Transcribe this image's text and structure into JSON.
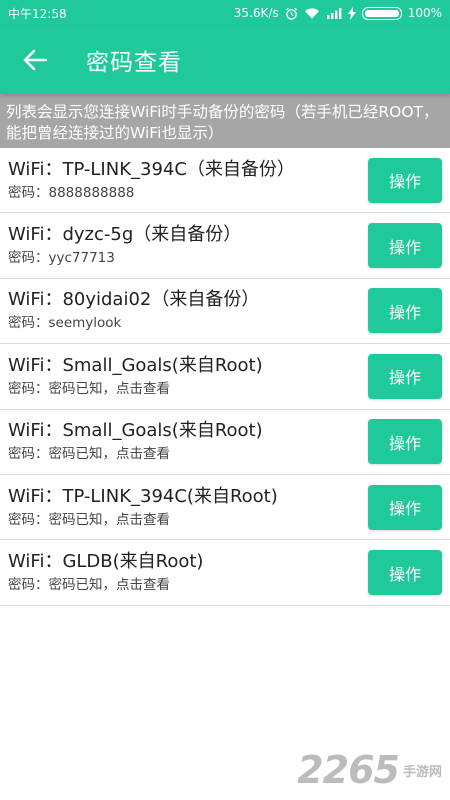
{
  "status_bar": {
    "time": "中午12:58",
    "speed": "35.6K/s",
    "battery": "100%"
  },
  "app_bar": {
    "title": "密码查看"
  },
  "notice": "列表会显示您连接WiFi时手动备份的密码（若手机已经ROOT，能把曾经连接过的WiFi也显示）",
  "items": [
    {
      "name": "WiFi：TP-LINK_394C（来自备份）",
      "password": "密码：8888888888",
      "button": "操作"
    },
    {
      "name": "WiFi：dyzc-5g（来自备份）",
      "password": "密码：yyc77713",
      "button": "操作"
    },
    {
      "name": "WiFi：80yidai02（来自备份）",
      "password": "密码：seemylook",
      "button": "操作"
    },
    {
      "name": "WiFi：Small_Goals(来自Root)",
      "password": "密码：密码已知，点击查看",
      "button": "操作"
    },
    {
      "name": "WiFi：Small_Goals(来自Root)",
      "password": "密码：密码已知，点击查看",
      "button": "操作"
    },
    {
      "name": "WiFi：TP-LINK_394C(来自Root)",
      "password": "密码：密码已知，点击查看",
      "button": "操作"
    },
    {
      "name": "WiFi：GLDB(来自Root)",
      "password": "密码：密码已知，点击查看",
      "button": "操作"
    }
  ],
  "watermark": {
    "number": "2265",
    "text": "手游网"
  },
  "colors": {
    "accent": "#20c99a",
    "notice_bg": "#a6a6a6"
  }
}
